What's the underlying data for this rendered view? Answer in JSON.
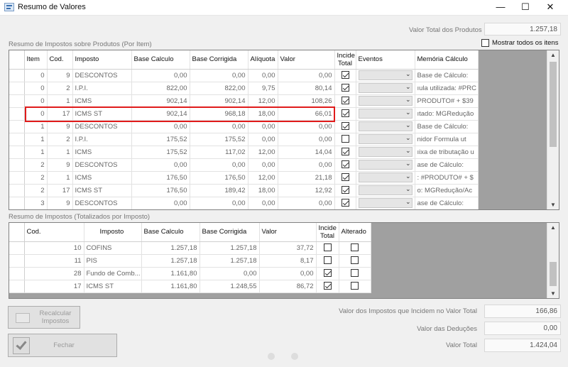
{
  "window": {
    "title": "Resumo de Valores",
    "minimize": "—",
    "maximize": "☐",
    "close": "✕"
  },
  "top": {
    "total_produtos_label": "Valor Total dos Produtos",
    "total_produtos_value": "1.257,18",
    "mostrar_todos_label": "Mostrar todos os itens",
    "mostrar_todos_checked": false
  },
  "grid1": {
    "label": "Resumo de Impostos sobre Produtos (Por Item)",
    "headers": {
      "item": "Item",
      "cod": "Cod.",
      "imposto": "Imposto",
      "base": "Base Calculo",
      "corrigida": "Base Corrigida",
      "aliquota": "Alíquota",
      "valor": "Valor",
      "incide1": "Incide",
      "incide2": "Total",
      "eventos": "Eventos",
      "memoria": "Memória Cálculo"
    },
    "rows": [
      {
        "item": "0",
        "cod": "9",
        "imposto": "DESCONTOS",
        "base": "0,00",
        "corrigida": "0,00",
        "aliquota": "0,00",
        "valor": "0,00",
        "incide": true,
        "memoria": "Base de Cálculo:"
      },
      {
        "item": "0",
        "cod": "2",
        "imposto": "I.P.I.",
        "base": "822,00",
        "corrigida": "822,00",
        "aliquota": "9,75",
        "valor": "80,14",
        "incide": true,
        "memoria": "ıula utilizada: #PRC"
      },
      {
        "item": "0",
        "cod": "1",
        "imposto": "ICMS",
        "base": "902,14",
        "corrigida": "902,14",
        "aliquota": "12,00",
        "valor": "108,26",
        "incide": true,
        "memoria": "PRODUTO# + $39"
      },
      {
        "item": "0",
        "cod": "17",
        "imposto": "ICMS ST",
        "base": "902,14",
        "corrigida": "968,18",
        "aliquota": "18,00",
        "valor": "66,01",
        "incide": true,
        "memoria": "ıtado: MGRedução"
      },
      {
        "item": "1",
        "cod": "9",
        "imposto": "DESCONTOS",
        "base": "0,00",
        "corrigida": "0,00",
        "aliquota": "0,00",
        "valor": "0,00",
        "incide": true,
        "memoria": "Base de Cálculo:"
      },
      {
        "item": "1",
        "cod": "2",
        "imposto": "I.P.I.",
        "base": "175,52",
        "corrigida": "175,52",
        "aliquota": "0,00",
        "valor": "0,00",
        "incide": false,
        "memoria": "nidor    Formula ut"
      },
      {
        "item": "1",
        "cod": "1",
        "imposto": "ICMS",
        "base": "175,52",
        "corrigida": "117,02",
        "aliquota": "12,00",
        "valor": "14,04",
        "incide": true,
        "memoria": "ıixa de tributação u"
      },
      {
        "item": "2",
        "cod": "9",
        "imposto": "DESCONTOS",
        "base": "0,00",
        "corrigida": "0,00",
        "aliquota": "0,00",
        "valor": "0,00",
        "incide": true,
        "memoria": "ase de Cálculo:"
      },
      {
        "item": "2",
        "cod": "1",
        "imposto": "ICMS",
        "base": "176,50",
        "corrigida": "176,50",
        "aliquota": "12,00",
        "valor": "21,18",
        "incide": true,
        "memoria": ": #PRODUTO# + $"
      },
      {
        "item": "2",
        "cod": "17",
        "imposto": "ICMS ST",
        "base": "176,50",
        "corrigida": "189,42",
        "aliquota": "18,00",
        "valor": "12,92",
        "incide": true,
        "memoria": "o: MGRedução/Ac"
      },
      {
        "item": "3",
        "cod": "9",
        "imposto": "DESCONTOS",
        "base": "0,00",
        "corrigida": "0,00",
        "aliquota": "0,00",
        "valor": "0,00",
        "incide": true,
        "memoria": "ase de Cálculo:"
      }
    ]
  },
  "grid2": {
    "label": "Resumo de Impostos (Totalizados por Imposto)",
    "headers": {
      "cod": "Cod.",
      "imposto": "Imposto",
      "base": "Base Calculo",
      "corrigida": "Base Corrigida",
      "valor": "Valor",
      "incide1": "Incide",
      "incide2": "Total",
      "alterado": "Alterado"
    },
    "rows": [
      {
        "cod": "10",
        "imposto": "COFINS",
        "base": "1.257,18",
        "corrigida": "1.257,18",
        "valor": "37,72",
        "incide": false,
        "alterado": false
      },
      {
        "cod": "11",
        "imposto": "PIS",
        "base": "1.257,18",
        "corrigida": "1.257,18",
        "valor": "8,17",
        "incide": false,
        "alterado": false
      },
      {
        "cod": "28",
        "imposto": "Fundo de Comb...",
        "base": "1.161,80",
        "corrigida": "0,00",
        "valor": "0,00",
        "incide": true,
        "alterado": false
      },
      {
        "cod": "17",
        "imposto": "ICMS ST",
        "base": "1.161,80",
        "corrigida": "1.248,55",
        "valor": "86,72",
        "incide": true,
        "alterado": false
      }
    ]
  },
  "buttons": {
    "recalcular": "Recalcular Impostos",
    "fechar": "Fechar"
  },
  "summary": {
    "impostos_label": "Valor dos Impostos que Incidem no Valor Total",
    "impostos_value": "166,86",
    "deducoes_label": "Valor das Deduções",
    "deducoes_value": "0,00",
    "total_label": "Valor Total",
    "total_value": "1.424,04"
  },
  "bottom_icons": [
    "zoom-out-icon",
    "zoom-in-icon"
  ]
}
